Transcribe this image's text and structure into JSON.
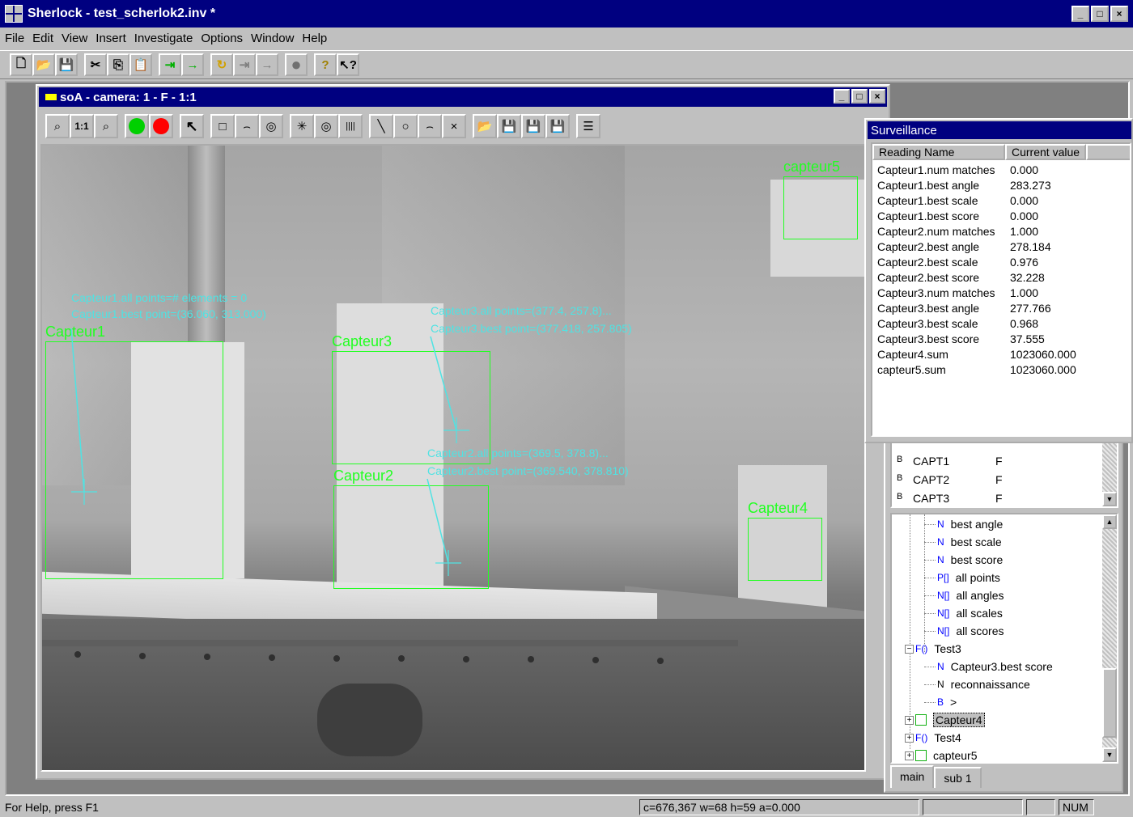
{
  "app": {
    "title": "Sherlock - test_scherlok2.inv *",
    "window_buttons": [
      "_",
      "□",
      "×"
    ]
  },
  "menu": [
    "File",
    "Edit",
    "View",
    "Insert",
    "Investigate",
    "Options",
    "Window",
    "Help"
  ],
  "toolbar": {
    "buttons": [
      {
        "icon": "new-file-icon",
        "glyph": "🗋"
      },
      {
        "icon": "open-folder-icon",
        "glyph": "📂"
      },
      {
        "icon": "save-icon",
        "glyph": "💾"
      },
      {
        "icon": "cut-icon",
        "glyph": "✂"
      },
      {
        "icon": "copy-icon",
        "glyph": "⎘"
      },
      {
        "icon": "paste-icon",
        "glyph": "📋"
      },
      {
        "icon": "step-into-icon",
        "glyph": "⇥"
      },
      {
        "icon": "run-icon",
        "glyph": "→"
      },
      {
        "icon": "loop-icon",
        "glyph": "↻"
      },
      {
        "icon": "step-disabled-icon",
        "glyph": "⇥"
      },
      {
        "icon": "run-disabled-icon",
        "glyph": "→"
      },
      {
        "icon": "stop-icon",
        "glyph": "●"
      },
      {
        "icon": "help-icon",
        "glyph": "?"
      },
      {
        "icon": "context-help-icon",
        "glyph": "↖?"
      }
    ]
  },
  "child_window": {
    "title": "soA - camera: 1 - F - 1:1",
    "toolbar": {
      "zoom_out": "⌕",
      "one_to_one": "1:1",
      "zoom_in": "⌕",
      "pointer": "↖",
      "rect": "□",
      "arc": "⌢",
      "ring": "◎",
      "burst": "✳",
      "rings": "◎",
      "bars": "||||",
      "line": "╲",
      "circle": "○",
      "arc2": "⌢",
      "cross": "×",
      "open": "📂",
      "save": "💾",
      "save_as": "💾",
      "export": "💾",
      "properties": "☰"
    },
    "regions": [
      {
        "id": "capteur1",
        "label": "Capteur1"
      },
      {
        "id": "capteur2",
        "label": "Capteur2"
      },
      {
        "id": "capteur3",
        "label": "Capteur3"
      },
      {
        "id": "capteur4",
        "label": "Capteur4"
      },
      {
        "id": "capteur5",
        "label": "capteur5"
      }
    ],
    "annotations": {
      "c1_all": "Capteur1.all points=# elements = 0",
      "c1_best": "Capteur1.best point=(36.060, 313.000)",
      "c3_all": "Capteur3.all points=(377.4, 257.8)...",
      "c3_best": "Capteur3.best point=(377.418, 257.805)",
      "c2_all": "Capteur2.all points=(369.5, 378.8)...",
      "c2_best": "Capteur2.best point=(369.540, 378.810)"
    },
    "colors": {
      "roi": "#22ff22",
      "annotation": "#4fe3e3"
    }
  },
  "surveillance": {
    "title": "Surveillance",
    "columns": [
      "Reading Name",
      "Current value"
    ],
    "rows": [
      [
        "Capteur1.num matches",
        "0.000"
      ],
      [
        "Capteur1.best angle",
        "283.273"
      ],
      [
        "Capteur1.best scale",
        "0.000"
      ],
      [
        "Capteur1.best score",
        "0.000"
      ],
      [
        "Capteur2.num matches",
        "1.000"
      ],
      [
        "Capteur2.best angle",
        "278.184"
      ],
      [
        "Capteur2.best scale",
        "0.976"
      ],
      [
        "Capteur2.best score",
        "32.228"
      ],
      [
        "Capteur3.num matches",
        "1.000"
      ],
      [
        "Capteur3.best angle",
        "277.766"
      ],
      [
        "Capteur3.best scale",
        "0.968"
      ],
      [
        "Capteur3.best score",
        "37.555"
      ],
      [
        "Capteur4.sum",
        "1023060.000"
      ],
      [
        "capteur5.sum",
        "1023060.000"
      ]
    ]
  },
  "variables": [
    {
      "type": "B",
      "name": "CAPT1",
      "value": "F"
    },
    {
      "type": "B",
      "name": "CAPT2",
      "value": "F"
    },
    {
      "type": "B",
      "name": "CAPT3",
      "value": "F"
    }
  ],
  "tree": {
    "items": [
      {
        "type": "N",
        "label": "best angle"
      },
      {
        "type": "N",
        "label": "best scale"
      },
      {
        "type": "N",
        "label": "best score"
      },
      {
        "type": "P[]",
        "label": "all points"
      },
      {
        "type": "N[]",
        "label": "all angles"
      },
      {
        "type": "N[]",
        "label": "all scales"
      },
      {
        "type": "N[]",
        "label": "all scores"
      },
      {
        "type": "F()",
        "label": "Test3"
      },
      {
        "type": "N",
        "label": "Capteur3.best score"
      },
      {
        "type": "N",
        "label": "reconnaissance"
      },
      {
        "type": "B",
        "label": ">"
      },
      {
        "type": "",
        "label": "Capteur4"
      },
      {
        "type": "F()",
        "label": "Test4"
      },
      {
        "type": "",
        "label": "capteur5"
      }
    ],
    "tabs": [
      "main",
      "sub 1"
    ]
  },
  "statusbar": {
    "help": "For Help, press F1",
    "coords": "c=676,367 w=68 h=59 a=0.000",
    "num": "NUM"
  }
}
